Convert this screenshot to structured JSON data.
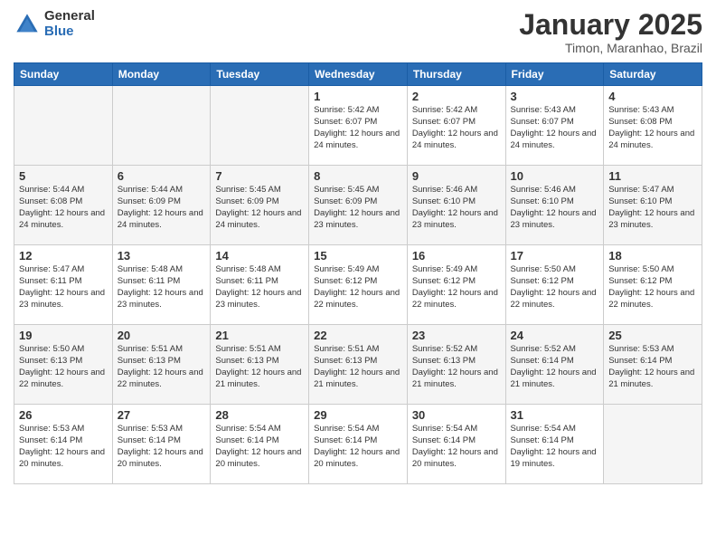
{
  "logo": {
    "general": "General",
    "blue": "Blue"
  },
  "header": {
    "title": "January 2025",
    "subtitle": "Timon, Maranhao, Brazil"
  },
  "weekdays": [
    "Sunday",
    "Monday",
    "Tuesday",
    "Wednesday",
    "Thursday",
    "Friday",
    "Saturday"
  ],
  "weeks": [
    [
      {
        "day": "",
        "info": ""
      },
      {
        "day": "",
        "info": ""
      },
      {
        "day": "",
        "info": ""
      },
      {
        "day": "1",
        "info": "Sunrise: 5:42 AM\nSunset: 6:07 PM\nDaylight: 12 hours\nand 24 minutes."
      },
      {
        "day": "2",
        "info": "Sunrise: 5:42 AM\nSunset: 6:07 PM\nDaylight: 12 hours\nand 24 minutes."
      },
      {
        "day": "3",
        "info": "Sunrise: 5:43 AM\nSunset: 6:07 PM\nDaylight: 12 hours\nand 24 minutes."
      },
      {
        "day": "4",
        "info": "Sunrise: 5:43 AM\nSunset: 6:08 PM\nDaylight: 12 hours\nand 24 minutes."
      }
    ],
    [
      {
        "day": "5",
        "info": "Sunrise: 5:44 AM\nSunset: 6:08 PM\nDaylight: 12 hours\nand 24 minutes."
      },
      {
        "day": "6",
        "info": "Sunrise: 5:44 AM\nSunset: 6:09 PM\nDaylight: 12 hours\nand 24 minutes."
      },
      {
        "day": "7",
        "info": "Sunrise: 5:45 AM\nSunset: 6:09 PM\nDaylight: 12 hours\nand 24 minutes."
      },
      {
        "day": "8",
        "info": "Sunrise: 5:45 AM\nSunset: 6:09 PM\nDaylight: 12 hours\nand 23 minutes."
      },
      {
        "day": "9",
        "info": "Sunrise: 5:46 AM\nSunset: 6:10 PM\nDaylight: 12 hours\nand 23 minutes."
      },
      {
        "day": "10",
        "info": "Sunrise: 5:46 AM\nSunset: 6:10 PM\nDaylight: 12 hours\nand 23 minutes."
      },
      {
        "day": "11",
        "info": "Sunrise: 5:47 AM\nSunset: 6:10 PM\nDaylight: 12 hours\nand 23 minutes."
      }
    ],
    [
      {
        "day": "12",
        "info": "Sunrise: 5:47 AM\nSunset: 6:11 PM\nDaylight: 12 hours\nand 23 minutes."
      },
      {
        "day": "13",
        "info": "Sunrise: 5:48 AM\nSunset: 6:11 PM\nDaylight: 12 hours\nand 23 minutes."
      },
      {
        "day": "14",
        "info": "Sunrise: 5:48 AM\nSunset: 6:11 PM\nDaylight: 12 hours\nand 23 minutes."
      },
      {
        "day": "15",
        "info": "Sunrise: 5:49 AM\nSunset: 6:12 PM\nDaylight: 12 hours\nand 22 minutes."
      },
      {
        "day": "16",
        "info": "Sunrise: 5:49 AM\nSunset: 6:12 PM\nDaylight: 12 hours\nand 22 minutes."
      },
      {
        "day": "17",
        "info": "Sunrise: 5:50 AM\nSunset: 6:12 PM\nDaylight: 12 hours\nand 22 minutes."
      },
      {
        "day": "18",
        "info": "Sunrise: 5:50 AM\nSunset: 6:12 PM\nDaylight: 12 hours\nand 22 minutes."
      }
    ],
    [
      {
        "day": "19",
        "info": "Sunrise: 5:50 AM\nSunset: 6:13 PM\nDaylight: 12 hours\nand 22 minutes."
      },
      {
        "day": "20",
        "info": "Sunrise: 5:51 AM\nSunset: 6:13 PM\nDaylight: 12 hours\nand 22 minutes."
      },
      {
        "day": "21",
        "info": "Sunrise: 5:51 AM\nSunset: 6:13 PM\nDaylight: 12 hours\nand 21 minutes."
      },
      {
        "day": "22",
        "info": "Sunrise: 5:51 AM\nSunset: 6:13 PM\nDaylight: 12 hours\nand 21 minutes."
      },
      {
        "day": "23",
        "info": "Sunrise: 5:52 AM\nSunset: 6:13 PM\nDaylight: 12 hours\nand 21 minutes."
      },
      {
        "day": "24",
        "info": "Sunrise: 5:52 AM\nSunset: 6:14 PM\nDaylight: 12 hours\nand 21 minutes."
      },
      {
        "day": "25",
        "info": "Sunrise: 5:53 AM\nSunset: 6:14 PM\nDaylight: 12 hours\nand 21 minutes."
      }
    ],
    [
      {
        "day": "26",
        "info": "Sunrise: 5:53 AM\nSunset: 6:14 PM\nDaylight: 12 hours\nand 20 minutes."
      },
      {
        "day": "27",
        "info": "Sunrise: 5:53 AM\nSunset: 6:14 PM\nDaylight: 12 hours\nand 20 minutes."
      },
      {
        "day": "28",
        "info": "Sunrise: 5:54 AM\nSunset: 6:14 PM\nDaylight: 12 hours\nand 20 minutes."
      },
      {
        "day": "29",
        "info": "Sunrise: 5:54 AM\nSunset: 6:14 PM\nDaylight: 12 hours\nand 20 minutes."
      },
      {
        "day": "30",
        "info": "Sunrise: 5:54 AM\nSunset: 6:14 PM\nDaylight: 12 hours\nand 20 minutes."
      },
      {
        "day": "31",
        "info": "Sunrise: 5:54 AM\nSunset: 6:14 PM\nDaylight: 12 hours\nand 19 minutes."
      },
      {
        "day": "",
        "info": ""
      }
    ]
  ]
}
